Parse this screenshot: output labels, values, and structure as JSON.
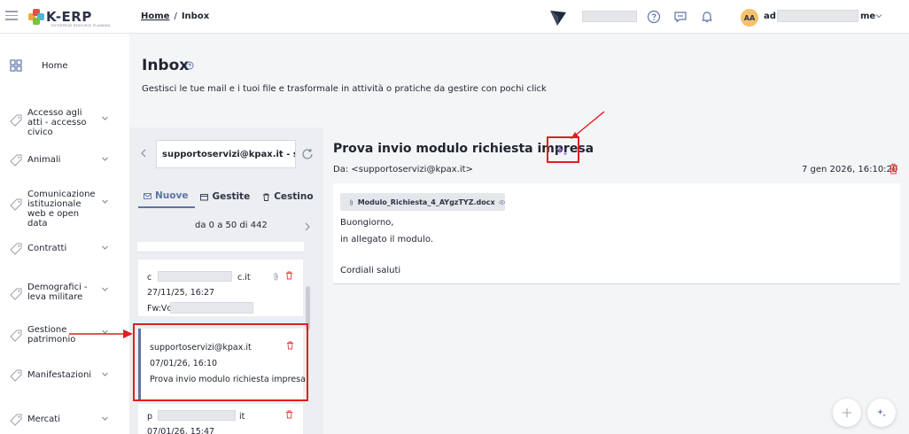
{
  "colors": {
    "accent": "#5d73a8",
    "danger": "#e53b3b",
    "annotation": "#e01f1f",
    "avatar_bg": "#f5c26b"
  },
  "app": {
    "logo_text": "K-ERP",
    "logo_subtitle": "ENTERPRISE RESOURCE PLANNING"
  },
  "breadcrumb": {
    "home": "Home",
    "separator": "/",
    "current": "Inbox"
  },
  "user": {
    "initials": "AA",
    "name_prefix": "ad",
    "name_suffix": "me"
  },
  "sidebar": {
    "items": [
      {
        "label": "Home",
        "icon": "grid-icon"
      },
      {
        "label": "Accesso agli atti - accesso civico",
        "icon": "tag-icon"
      },
      {
        "label": "Animali",
        "icon": "tag-icon"
      },
      {
        "label": "Comunicazione istituzionale web e open data",
        "icon": "tag-icon"
      },
      {
        "label": "Contratti",
        "icon": "tag-icon"
      },
      {
        "label": "Demografici - leva militare",
        "icon": "tag-icon"
      },
      {
        "label": "Gestione patrimonio",
        "icon": "tag-icon"
      },
      {
        "label": "Manifestazioni",
        "icon": "tag-icon"
      },
      {
        "label": "Mercati",
        "icon": "tag-icon"
      }
    ]
  },
  "header": {
    "title": "Inbox",
    "description": "Gestisci le tue mail e i tuoi file e trasformale in attività o pratiche da gestire con pochi click"
  },
  "inbox": {
    "account": "supportoservizi@kpax.it - supportoservizi",
    "tabs": [
      {
        "label": "Nuove",
        "icon": "mail-icon"
      },
      {
        "label": "Gestite",
        "icon": "folder-icon"
      },
      {
        "label": "Cestino",
        "icon": "trash-icon"
      }
    ],
    "paging": "da 0 a 50 di 442",
    "messages": [
      {
        "from_prefix": "c",
        "from_suffix": "c.it",
        "date": "27/11/25, 16:27",
        "subject_prefix": "Fw:Vc"
      },
      {
        "from": "supportoservizi@kpax.it",
        "date": "07/01/26, 16:10",
        "subject": "Prova invio modulo richiesta impresa"
      },
      {
        "from_prefix": "p",
        "from_suffix": "it",
        "date": "07/01/26, 15:47"
      }
    ]
  },
  "message": {
    "subject": "Prova invio modulo richiesta impresa",
    "from": "Da: <supportoservizi@kpax.it>",
    "date": "7 gen 2026, 16:10:20",
    "attachment": "Modulo_Richiesta_4_AYgzTYZ.docx",
    "body": [
      "Buongiorno,",
      "in allegato il modulo.",
      "",
      "Cordiali saluti"
    ]
  }
}
